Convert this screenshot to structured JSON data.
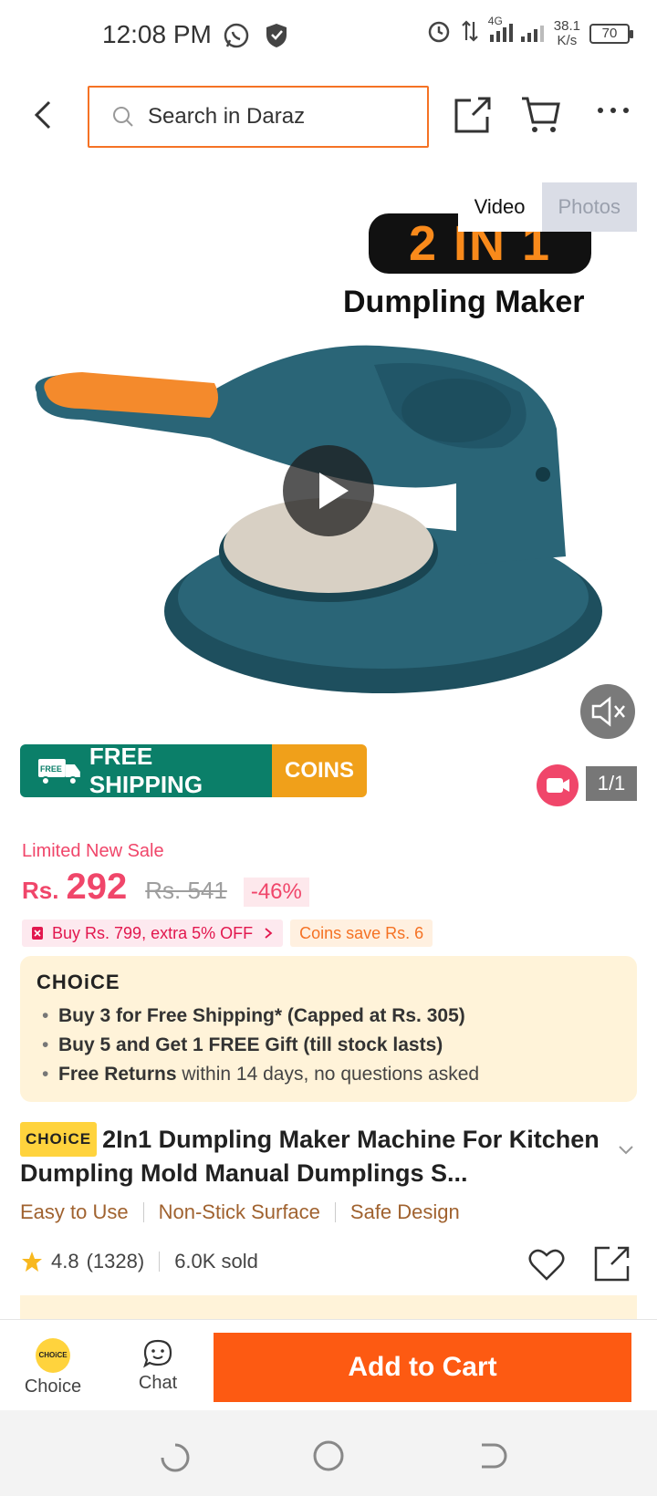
{
  "status": {
    "time": "12:08 PM",
    "net_speed_value": "38.1",
    "net_speed_unit": "K/s",
    "net_type": "4G",
    "battery": "70"
  },
  "header": {
    "search_placeholder": "Search in Daraz"
  },
  "media": {
    "tabs": [
      {
        "label": "Video"
      },
      {
        "label": "Photos"
      }
    ],
    "headline": "2 IN 1",
    "subheadline": "Dumpling Maker",
    "counter": "1/1",
    "shipping_label": "FREE SHIPPING",
    "shipping_icon_text": "FREE",
    "coins_label": "COINS"
  },
  "price": {
    "sale_label": "Limited New Sale",
    "currency": "Rs.",
    "current": "292",
    "original": "Rs. 541",
    "discount": "-46%"
  },
  "promos": {
    "buy_more": "Buy Rs. 799, extra 5% OFF",
    "coins_save": "Coins save Rs. 6"
  },
  "choice": {
    "logo": "CHOiCE",
    "items": [
      {
        "bold": "Buy 3 for  Free Shipping* (Capped at Rs. 305)",
        "rest": ""
      },
      {
        "bold": "Buy 5 and Get 1 FREE Gift (till stock lasts)",
        "rest": ""
      },
      {
        "bold": "Free Returns",
        "rest": " within 14 days, no questions asked"
      }
    ]
  },
  "product": {
    "badge": "CHOiCE",
    "title": "2In1 Dumpling Maker Machine For Kitchen Dumpling Mold Manual Dumplings S...",
    "features": [
      "Easy to Use",
      "Non-Stick Surface",
      "Safe Design"
    ],
    "rating": "4.8",
    "reviews": "(1328)",
    "sold": "6.0K sold"
  },
  "bottom": {
    "choice_label": "Choice",
    "choice_icon_text": "CHOiCE",
    "chat_label": "Chat",
    "add_to_cart": "Add to Cart"
  },
  "colors": {
    "accent": "#f57224",
    "cta": "#fd5a12",
    "price": "#f0466a",
    "shipping": "#0b7f69",
    "coins": "#f0a01a",
    "choice_bg": "#fff3d9"
  }
}
